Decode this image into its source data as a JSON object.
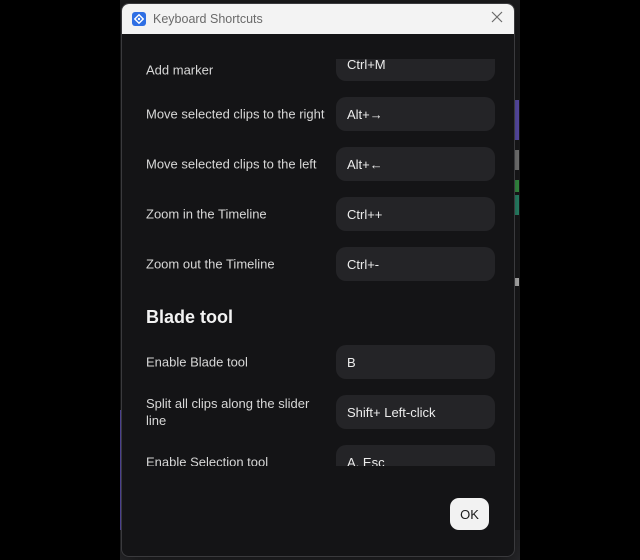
{
  "window": {
    "title": "Keyboard Shortcuts",
    "app_icon": "app-logo-icon",
    "close_icon": "close-icon",
    "accent": "#2f6fe4"
  },
  "shortcuts": [
    {
      "label": "Add marker",
      "keys": "Ctrl+M"
    },
    {
      "label": "Move selected clips to the right",
      "keys": "Alt+→"
    },
    {
      "label": "Move selected clips to the left",
      "keys": "Alt+←"
    },
    {
      "label": "Zoom in the Timeline",
      "keys": "Ctrl++"
    },
    {
      "label": "Zoom out the Timeline",
      "keys": "Ctrl+-"
    }
  ],
  "blade_section": {
    "title": "Blade tool",
    "items": [
      {
        "label": "Enable Blade tool",
        "keys": "B"
      },
      {
        "label": "Split all clips along the slider line",
        "keys": "Shift+ Left-click"
      },
      {
        "label": "Enable Selection tool",
        "keys": "A, Esc"
      }
    ]
  },
  "footer": {
    "ok_label": "OK"
  }
}
